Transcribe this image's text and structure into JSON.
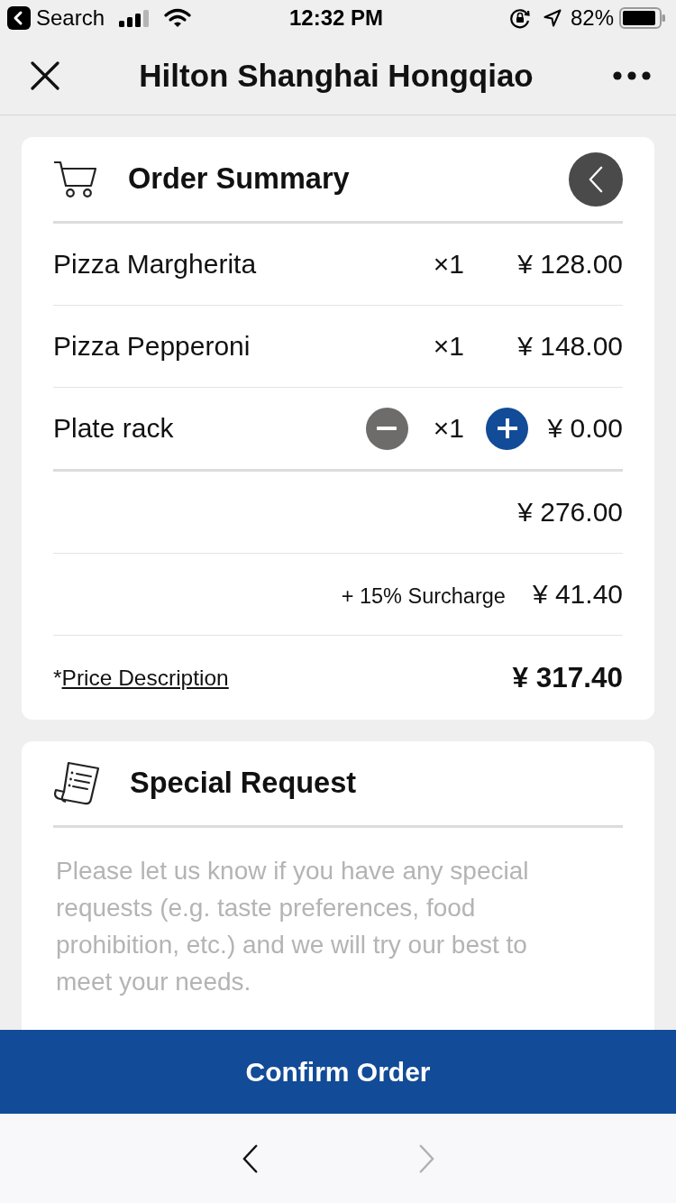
{
  "status_bar": {
    "back_label": "Search",
    "time": "12:32 PM",
    "battery": "82%"
  },
  "nav_bar": {
    "title": "Hilton Shanghai Hongqiao"
  },
  "order_summary": {
    "title": "Order Summary",
    "items": [
      {
        "kind": "fixed",
        "name": "Pizza Margherita",
        "quantity": "×1",
        "price": "¥ 128.00"
      },
      {
        "kind": "fixed",
        "name": "Pizza Pepperoni",
        "quantity": "×1",
        "price": "¥ 148.00"
      },
      {
        "kind": "stepper",
        "name": "Plate rack",
        "quantity": "×1",
        "price": "¥ 0.00"
      }
    ],
    "subtotal": "¥ 276.00",
    "surcharge": {
      "label": "+ 15% Surcharge",
      "amount": "¥ 41.40"
    },
    "price_note": {
      "mark": "*",
      "link": "Price Description"
    },
    "total": "¥ 317.40"
  },
  "special_request": {
    "title": "Special Request",
    "placeholder": "Please let us know if you have any special requests (e.g. taste preferences, food prohibition, etc.) and we will try our best to meet your needs."
  },
  "confirm_button": "Confirm Order",
  "browser_nav": [
    {
      "kind": "back",
      "disabled": false
    },
    {
      "kind": "forward",
      "disabled": true
    }
  ]
}
